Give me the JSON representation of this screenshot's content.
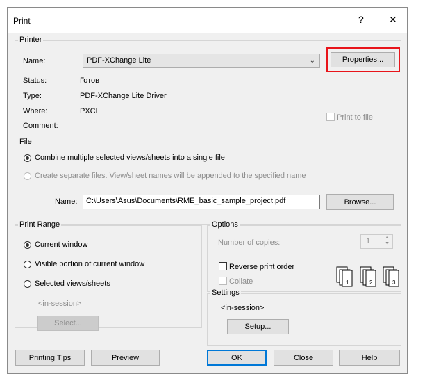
{
  "dialog": {
    "title": "Print",
    "help_glyph": "?",
    "close_glyph": "✕"
  },
  "printer": {
    "group_label": "Printer",
    "name_label": "Name:",
    "name_value": "PDF-XChange Lite",
    "properties_label": "Properties...",
    "status_label": "Status:",
    "status_value": "Готов",
    "type_label": "Type:",
    "type_value": "PDF-XChange Lite Driver",
    "where_label": "Where:",
    "where_value": "PXCL",
    "comment_label": "Comment:",
    "print_to_file_label": "Print to file"
  },
  "file": {
    "group_label": "File",
    "combine_label": "Combine multiple selected views/sheets into a single file",
    "separate_label": "Create separate files. View/sheet names will be appended to the specified name",
    "name_label": "Name:",
    "name_value": "C:\\Users\\Asus\\Documents\\RME_basic_sample_project.pdf",
    "browse_label": "Browse..."
  },
  "print_range": {
    "group_label": "Print Range",
    "current_window_label": "Current window",
    "visible_portion_label": "Visible portion of current window",
    "selected_views_label": "Selected views/sheets",
    "in_session_label": "<in-session>",
    "select_label": "Select..."
  },
  "options": {
    "group_label": "Options",
    "copies_label": "Number of copies:",
    "copies_value": "1",
    "reverse_label": "Reverse print order",
    "collate_label": "Collate",
    "page_numbers": [
      "1",
      "2",
      "3"
    ]
  },
  "settings": {
    "group_label": "Settings",
    "in_session_label": "<in-session>",
    "setup_label": "Setup..."
  },
  "buttons": {
    "printing_tips": "Printing Tips",
    "preview": "Preview",
    "ok": "OK",
    "close": "Close",
    "help": "Help"
  },
  "colors": {
    "highlight": "#e8141a",
    "default_button_border": "#0078d7"
  }
}
